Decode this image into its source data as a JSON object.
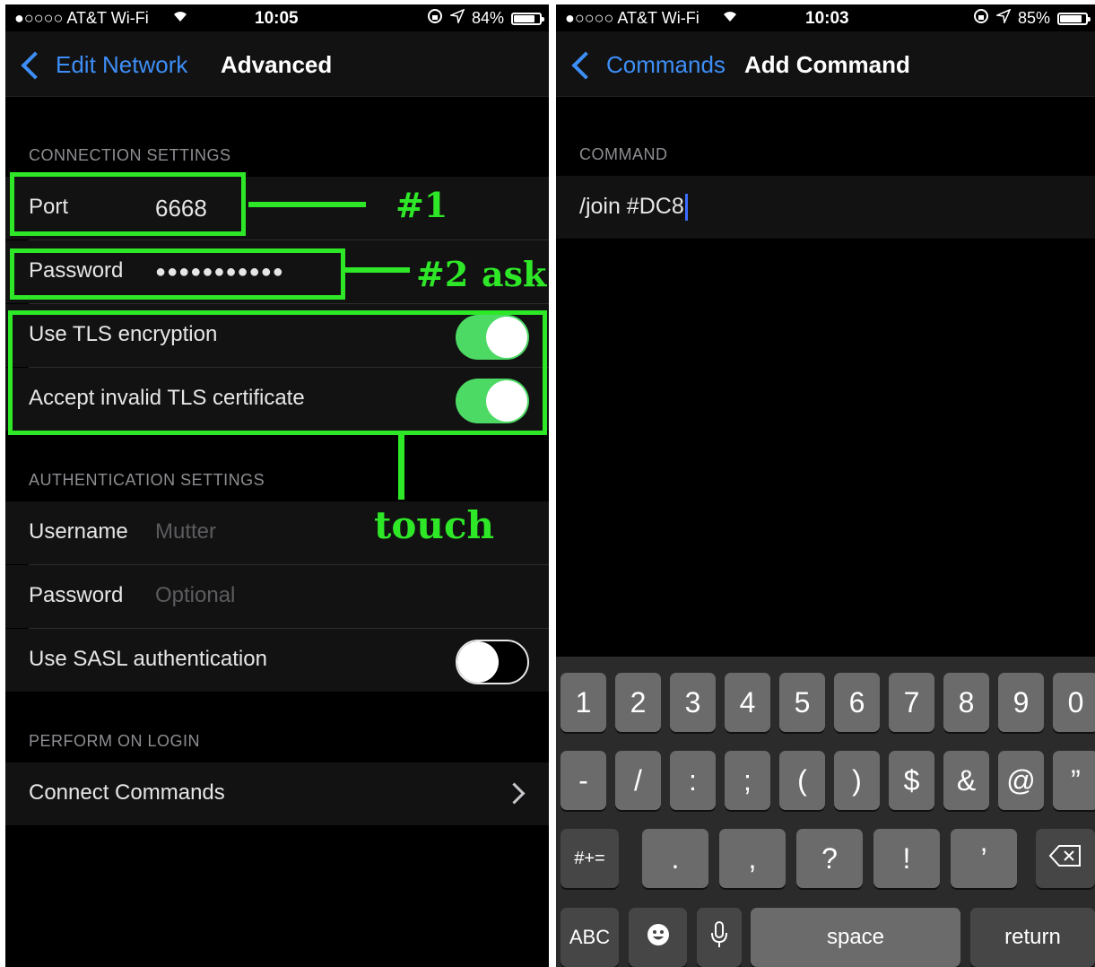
{
  "left": {
    "status": {
      "carrier": "●○○○○ AT&T Wi-Fi",
      "time": "10:05",
      "battery": "84%",
      "battery_level": 0.84
    },
    "nav": {
      "back_label": "Edit Network",
      "title": "Advanced"
    },
    "connection": {
      "header": "CONNECTION SETTINGS",
      "port_label": "Port",
      "port_value": "6668",
      "password_label": "Password",
      "password_value": "●●●●●●●●●●●",
      "tls_label": "Use TLS encryption",
      "tls_on": true,
      "invalid_tls_label": "Accept invalid TLS certificate",
      "invalid_tls_on": true
    },
    "auth": {
      "header": "AUTHENTICATION SETTINGS",
      "username_label": "Username",
      "username_placeholder": "Mutter",
      "password_label": "Password",
      "password_placeholder": "Optional",
      "sasl_label": "Use SASL authentication",
      "sasl_on": false
    },
    "login": {
      "header": "PERFORM ON LOGIN",
      "connect_commands_label": "Connect Commands"
    },
    "annotations": {
      "one": "#1",
      "two": "#2",
      "ask": "ask",
      "touch": "touch",
      "color": "#2ee828"
    }
  },
  "right": {
    "status": {
      "carrier": "●○○○○ AT&T Wi-Fi",
      "time": "10:03",
      "battery": "85%",
      "battery_level": 0.85
    },
    "nav": {
      "back_label": "Commands",
      "title": "Add Command"
    },
    "command": {
      "header": "COMMAND",
      "value": "/join #DC8"
    },
    "keyboard": {
      "row1": [
        "1",
        "2",
        "3",
        "4",
        "5",
        "6",
        "7",
        "8",
        "9",
        "0"
      ],
      "row2": [
        "-",
        "/",
        ":",
        ";",
        "(",
        ")",
        "$",
        "&",
        "@",
        "”"
      ],
      "row3_left": "#+=",
      "row3": [
        ".",
        ",",
        "?",
        "!",
        "’"
      ],
      "abc": "ABC",
      "space": "space",
      "return": "return"
    }
  },
  "colors": {
    "accent_blue": "#3d8ef6",
    "toggle_green": "#4cd964",
    "annotation_green": "#2ee828"
  }
}
